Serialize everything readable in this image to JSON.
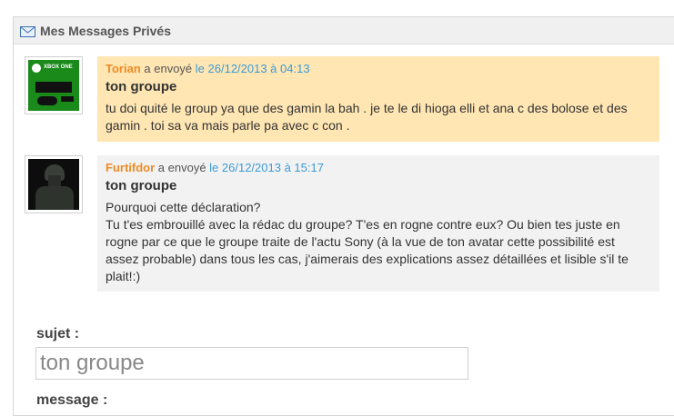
{
  "panel": {
    "title": "Mes Messages Privés",
    "icon": "envelope-icon"
  },
  "messages": [
    {
      "author": "Torian",
      "sent_label": "a envoyé",
      "date": "le 26/12/2013 à 04:13",
      "subject": "ton groupe",
      "body": "tu doi quité le group ya que des gamin la bah . je te le di hioga elli et ana c des bolose et des gamin . toi sa va mais parle pa avec c con .",
      "avatar_text": "XBOX ONE",
      "avatar": "xbox-one-avatar",
      "background": "#ffe6b3"
    },
    {
      "author": "Furtifdor",
      "sent_label": "a envoyé",
      "date": "le 26/12/2013 à 15:17",
      "subject": "ton groupe",
      "body": "Pourquoi cette déclaration?\nTu t'es embrouillé avec la rédac du groupe? T'es en rogne contre eux? Ou bien tes juste en rogne par ce que le groupe traite de l'actu Sony (à la vue de ton avatar cette possibilité est assez probable) dans tous les cas, j'aimerais des explications assez détaillées et lisible s'il te plait!:)",
      "avatar": "soldier-avatar",
      "background": "#f2f2f2"
    }
  ],
  "form": {
    "subject_label": "sujet :",
    "subject_value": "ton groupe",
    "message_label": "message :"
  },
  "colors": {
    "author": "#f08a24",
    "date": "#3d9ad6"
  }
}
